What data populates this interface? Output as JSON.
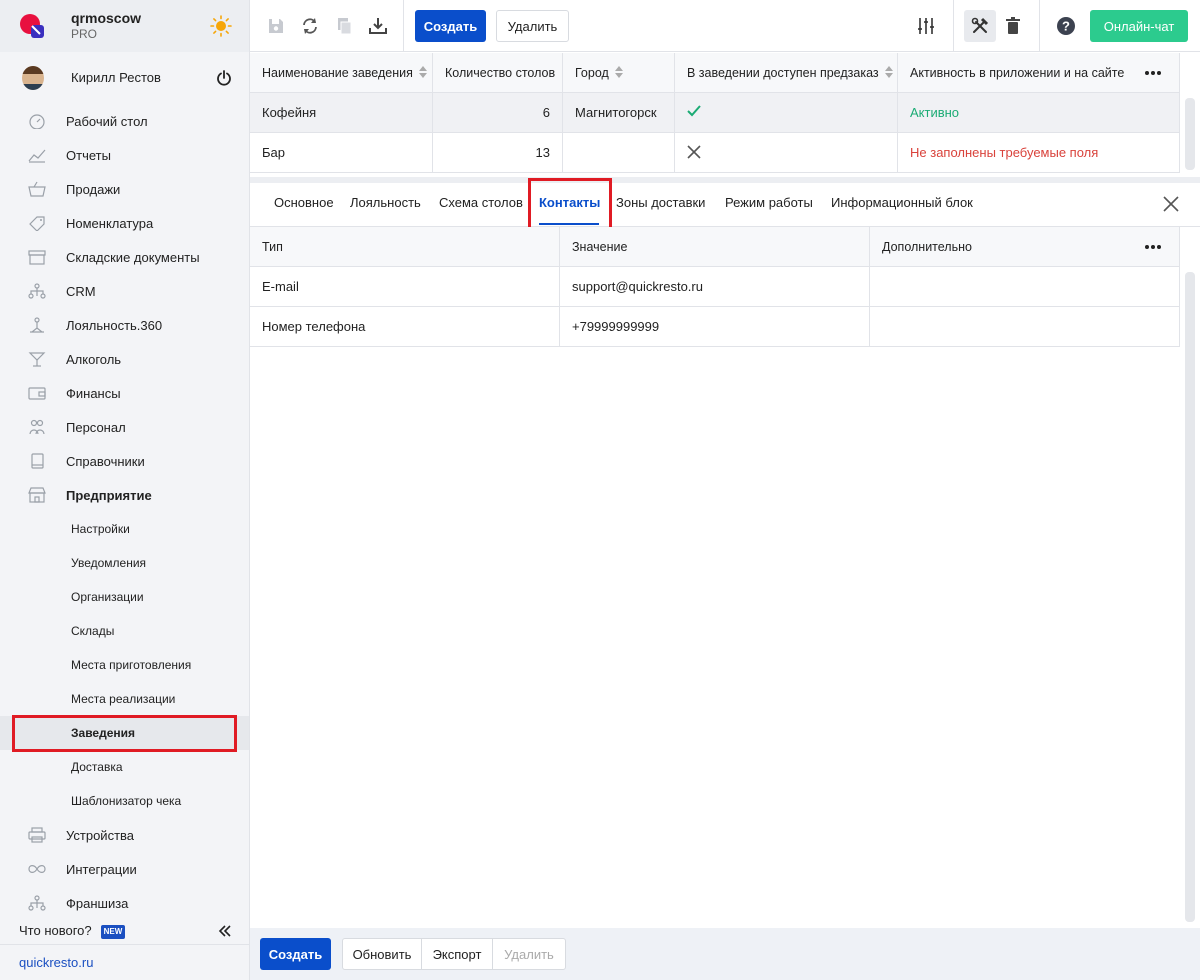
{
  "brand": {
    "name": "qrmoscow",
    "plan": "PRO"
  },
  "user": {
    "name": "Кирилл Рестов"
  },
  "nav": [
    {
      "label": "Рабочий стол",
      "icon": "dashboard-icon"
    },
    {
      "label": "Отчеты",
      "icon": "chart-icon"
    },
    {
      "label": "Продажи",
      "icon": "basket-icon"
    },
    {
      "label": "Номенклатура",
      "icon": "tag-icon"
    },
    {
      "label": "Складские документы",
      "icon": "box-icon"
    },
    {
      "label": "CRM",
      "icon": "hierarchy-icon"
    },
    {
      "label": "Лояльность.360",
      "icon": "loyalty-icon"
    },
    {
      "label": "Алкоголь",
      "icon": "cocktail-icon"
    },
    {
      "label": "Финансы",
      "icon": "wallet-icon"
    },
    {
      "label": "Персонал",
      "icon": "people-icon"
    },
    {
      "label": "Справочники",
      "icon": "book-icon"
    },
    {
      "label": "Предприятие",
      "icon": "store-icon"
    }
  ],
  "subnav": [
    {
      "label": "Настройки"
    },
    {
      "label": "Уведомления"
    },
    {
      "label": "Организации"
    },
    {
      "label": "Склады"
    },
    {
      "label": "Места приготовления"
    },
    {
      "label": "Места реализации"
    },
    {
      "label": "Заведения"
    },
    {
      "label": "Доставка"
    },
    {
      "label": "Шаблонизатор чека"
    }
  ],
  "nav_bottom": [
    {
      "label": "Устройства",
      "icon": "printer-icon"
    },
    {
      "label": "Интеграции",
      "icon": "infinity-icon"
    },
    {
      "label": "Франшиза",
      "icon": "hierarchy-icon"
    }
  ],
  "whats_new": {
    "label": "Что нового?",
    "badge": "NEW"
  },
  "site_link": "quickresto.ru",
  "toolbar": {
    "create": "Создать",
    "delete": "Удалить",
    "chat": "Онлайн-чат"
  },
  "top_table": {
    "headers": [
      "Наименование заведения",
      "Количество столов",
      "Город",
      "В заведении доступен предзаказ",
      "Активность в приложении и на сайте"
    ],
    "rows": [
      {
        "name": "Кофейня",
        "tables": "6",
        "city": "Магнитогорск",
        "preorder": true,
        "activity": "Активно",
        "activity_color": "#1bab74"
      },
      {
        "name": "Бар",
        "tables": "13",
        "city": "",
        "preorder": false,
        "activity": "Не заполнены требуемые поля",
        "activity_color": "#d9423b"
      }
    ]
  },
  "tabs": [
    "Основное",
    "Лояльность",
    "Схема столов",
    "Контакты",
    "Зоны доставки",
    "Режим работы",
    "Информационный блок"
  ],
  "active_tab": "Контакты",
  "contacts": {
    "headers": [
      "Тип",
      "Значение",
      "Дополнительно"
    ],
    "rows": [
      {
        "type": "E-mail",
        "value": "support@quickresto.ru",
        "extra": ""
      },
      {
        "type": "Номер телефона",
        "value": "+79999999999",
        "extra": ""
      }
    ]
  },
  "bottom": {
    "create": "Создать",
    "refresh": "Обновить",
    "export": "Экспорт",
    "delete": "Удалить"
  },
  "colors": {
    "primary": "#0a4ecb",
    "chat": "#2ccb8e",
    "highlight": "#e01b24"
  }
}
